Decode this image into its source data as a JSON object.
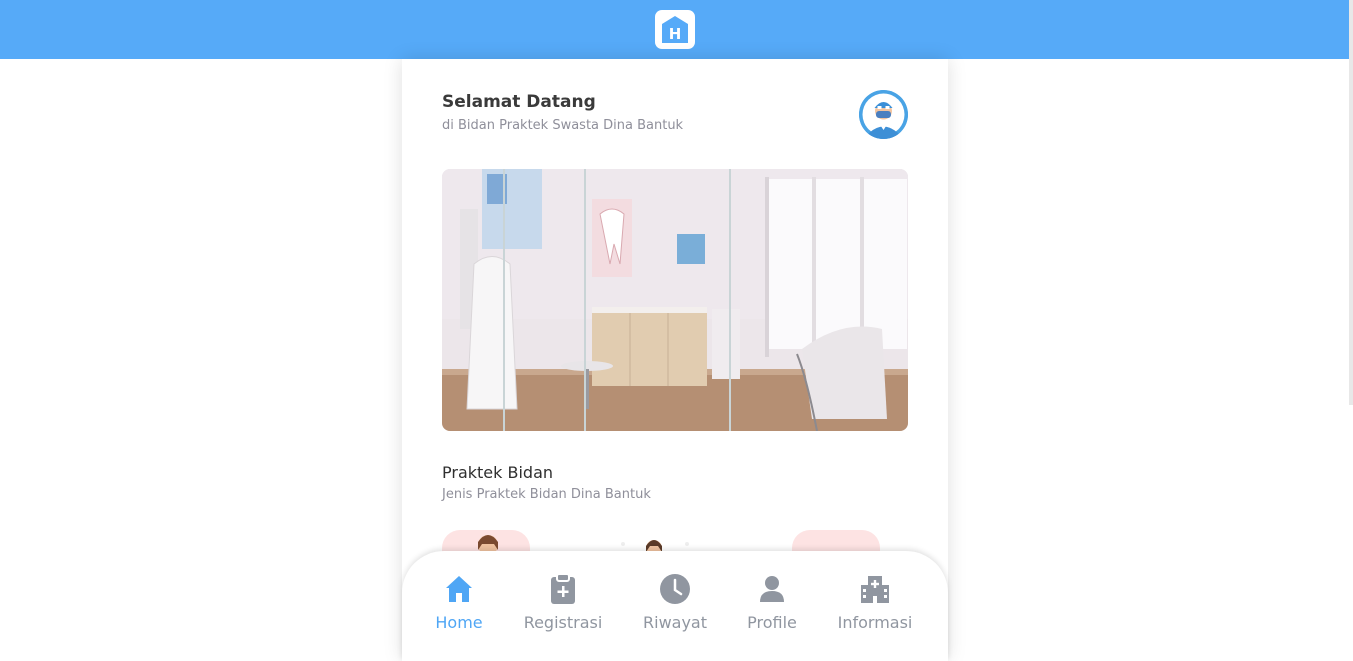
{
  "header": {
    "logo_letter": "H",
    "brand_color": "#56aaf8"
  },
  "welcome": {
    "title": "Selamat Datang",
    "subtitle": "di Bidan Praktek Swasta Dina Bantuk"
  },
  "section": {
    "title": "Praktek Bidan",
    "subtitle": "Jenis Praktek Bidan Dina Bantuk"
  },
  "nav": {
    "active_color": "#4fa6f5",
    "inactive_color": "#9096a0",
    "items": [
      {
        "label": "Home",
        "icon": "home-icon",
        "active": true
      },
      {
        "label": "Registrasi",
        "icon": "clipboard-plus-icon",
        "active": false
      },
      {
        "label": "Riwayat",
        "icon": "clock-icon",
        "active": false
      },
      {
        "label": "Profile",
        "icon": "user-icon",
        "active": false
      },
      {
        "label": "Informasi",
        "icon": "hospital-icon",
        "active": false
      }
    ]
  }
}
